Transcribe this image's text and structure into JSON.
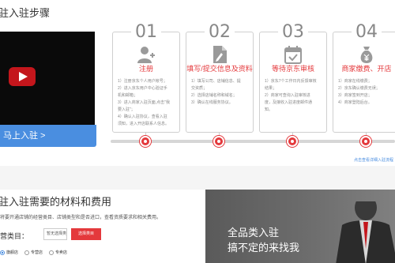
{
  "section1": {
    "title": "驻入驻步骤",
    "enter_button": "马上入驻 >"
  },
  "steps": [
    {
      "num": "01",
      "title": "注册",
      "icon": "user-add-icon",
      "items": [
        "1）注册京东个人用户帐号；",
        "2）进入京东用户中心验证手",
        "机和邮箱；",
        "3）进入商家入驻页面,点击\"我",
        "要入驻\"；",
        "4）确认入驻协议，查看入驻",
        "须知，进入开店联系人信息。"
      ]
    },
    {
      "num": "02",
      "title": "填写/提交信息及资料",
      "icon": "document-edit-icon",
      "items": [
        "1）填写公司、店铺信息、提",
        "交资质；",
        "2）选择店铺名称和域名；",
        "3）确认在线服务协议。"
      ]
    },
    {
      "num": "03",
      "title": "等待京东审核",
      "icon": "calendar-check-icon",
      "items": [
        "1）京东7个工作日内反馈审核",
        "结果；",
        "2）商家可查询入驻审核进",
        "度，及接收入驻进度邮件通",
        "知。"
      ]
    },
    {
      "num": "04",
      "title": "商家缴费、开店",
      "icon": "money-bag-icon",
      "items": [
        "1）商家在线缴费；",
        "2）京东确认缴费无误；",
        "3）商家签到开店；",
        "4）商家登陆后台。"
      ]
    }
  ],
  "apply_link": "点击查看详细入驻流程",
  "section2": {
    "title": "驻入驻需要的材料和费用",
    "description": "将要开通店铺的经营类目、店铺类型和是否进口，查看资质要求和相关费用。",
    "category_label": "营类目：",
    "category_placeholder": "暂无选择类目",
    "category_button": "选择类目",
    "radios": [
      {
        "label": "旗舰店",
        "checked": true
      },
      {
        "label": "专营店",
        "checked": false
      },
      {
        "label": "专卖店",
        "checked": false
      }
    ]
  },
  "banner": {
    "line1": "全品类入驻",
    "line2": "搞不定的来找我"
  },
  "colors": {
    "accent": "#e4393c",
    "blue": "#4a8ee0",
    "border": "#cfcfcf"
  }
}
